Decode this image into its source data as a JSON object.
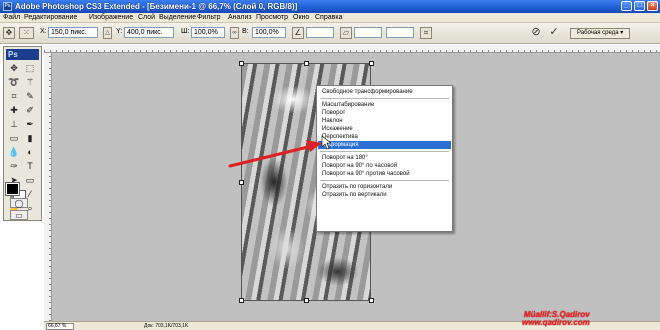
{
  "window": {
    "title": "Adobe Photoshop CS3 Extended - [Безимени-1 @ 66,7% (Слой 0, RGB/8)]",
    "app_icon_text": "Ps",
    "minimize": "_",
    "maximize": "□",
    "close": "×"
  },
  "menubar": {
    "items": [
      "Файл",
      "Редактирование",
      "Изображение",
      "Слой",
      "Выделение",
      "Фильтр",
      "Анализ",
      "Просмотр",
      "Окно",
      "Справка"
    ]
  },
  "options": {
    "x_label": "X:",
    "x_value": "150,0 пикс.",
    "y_label": "Y:",
    "y_value": "400,0 пикс.",
    "w_label": "Ш:",
    "w_value": "100,0%",
    "h_label": "В:",
    "h_value": "100,0%",
    "workspace": "Рабочая среда ▾"
  },
  "toolbox": {
    "logo": "Ps"
  },
  "context_menu": {
    "items": [
      "Свободное трансформирование",
      "Масштабирование",
      "Поворот",
      "Наклон",
      "Искажение",
      "Перспектива",
      "Деформация",
      "Поворот на 180°",
      "Поворот на 90° по часовой",
      "Поворот на 90° против часовой",
      "Отразить по горизонтали",
      "Отразить по вертикали"
    ],
    "selected": "Деформация"
  },
  "status": {
    "zoom": "66,67 %",
    "doc": "Док: 703,1K/703,1K"
  },
  "watermark": {
    "line1": "Müallif:S.Qadirov",
    "line2": "www.qadirov.com",
    "color": "#ff2020"
  },
  "colors": {
    "titlebar": "#1f5fd6",
    "menu_highlight": "#2a6fd6",
    "arrow": "#e02020"
  }
}
